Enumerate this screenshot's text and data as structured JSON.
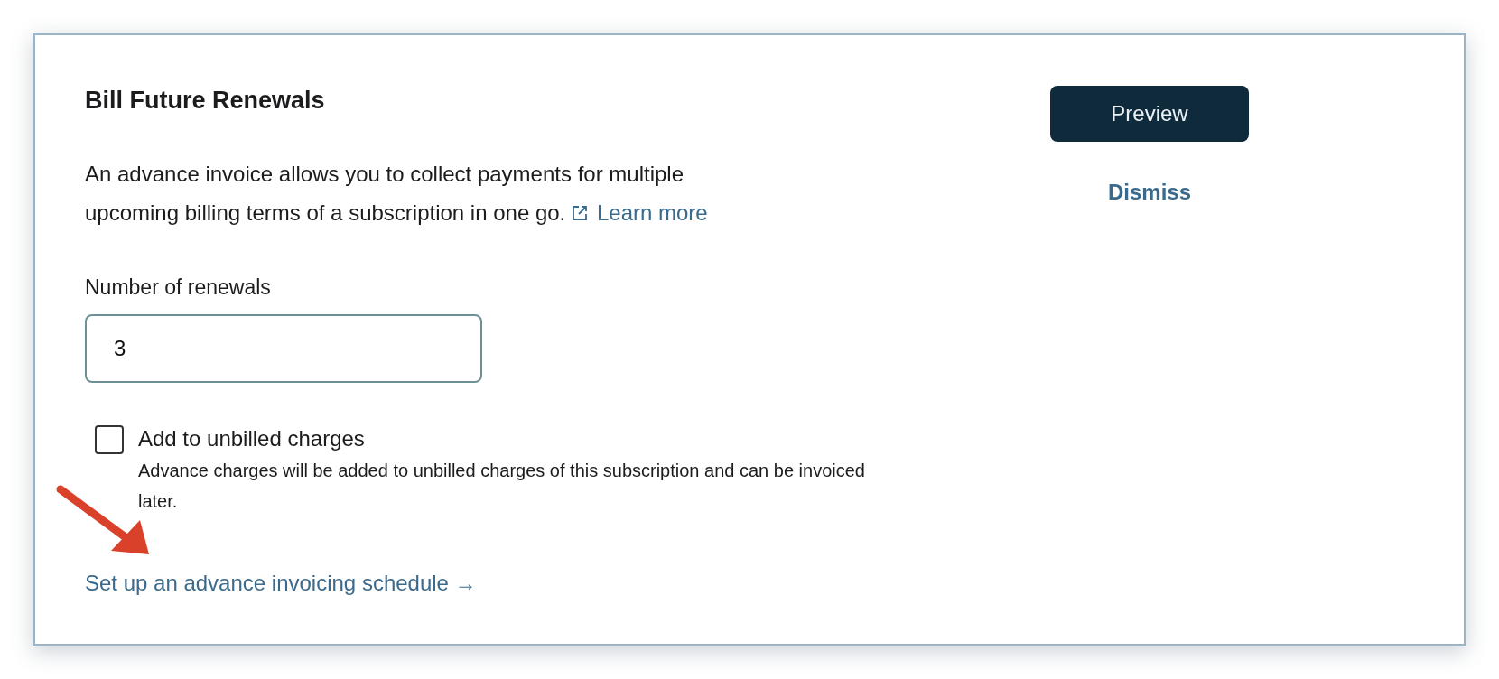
{
  "card": {
    "title": "Bill Future Renewals",
    "description": "An advance invoice allows you to collect payments for multiple upcoming billing terms of a subscription in one go.",
    "learn_more": "Learn more",
    "renewals": {
      "label": "Number of renewals",
      "value": "3"
    },
    "unbilled": {
      "label": "Add to unbilled charges",
      "checked": false,
      "help": "Advance charges will be added to unbilled charges of this subscription and can be invoiced later."
    },
    "schedule_link": "Set up an advance invoicing schedule →"
  },
  "actions": {
    "preview": "Preview",
    "dismiss": "Dismiss"
  }
}
